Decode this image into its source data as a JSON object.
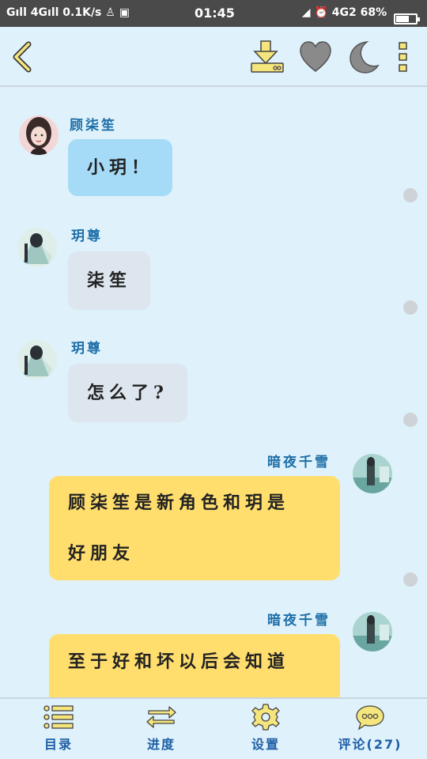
{
  "status_bar": {
    "signal": "G",
    "network1": "4G",
    "speed": "0.1K/s",
    "time": "01:45",
    "network2": "4G2",
    "battery": "68%",
    "battery_level": 0.68
  },
  "toolbar": {
    "icons": [
      "back-arrow-icon",
      "download-icon",
      "heart-icon",
      "moon-icon",
      "more-vertical-icon"
    ]
  },
  "messages": [
    {
      "side": "left",
      "sender": "顾柒笙",
      "text": "小玥！",
      "bubble_color": "#a5dbf6"
    },
    {
      "side": "left",
      "sender": "玥尊",
      "text": "柒笙",
      "bubble_color": "#dde5ee"
    },
    {
      "side": "left",
      "sender": "玥尊",
      "text": "怎么了?",
      "bubble_color": "#dde5ee"
    },
    {
      "side": "right",
      "sender": "暗夜千雪",
      "text_line1": "顾柒笙是新角色和玥是",
      "text_line2": "好朋友",
      "bubble_color": "#ffde6e"
    },
    {
      "side": "right",
      "sender": "暗夜千雪",
      "text": "至于好和坏以后会知道",
      "bubble_color": "#ffde6e"
    }
  ],
  "bottom_nav": {
    "catalog": "目录",
    "progress": "进度",
    "settings": "设置",
    "comments": "评论(27)"
  },
  "colors": {
    "background": "#dff1fb",
    "accent_blue": "#1d5ea6",
    "icon_yellow": "#f4e57c"
  }
}
